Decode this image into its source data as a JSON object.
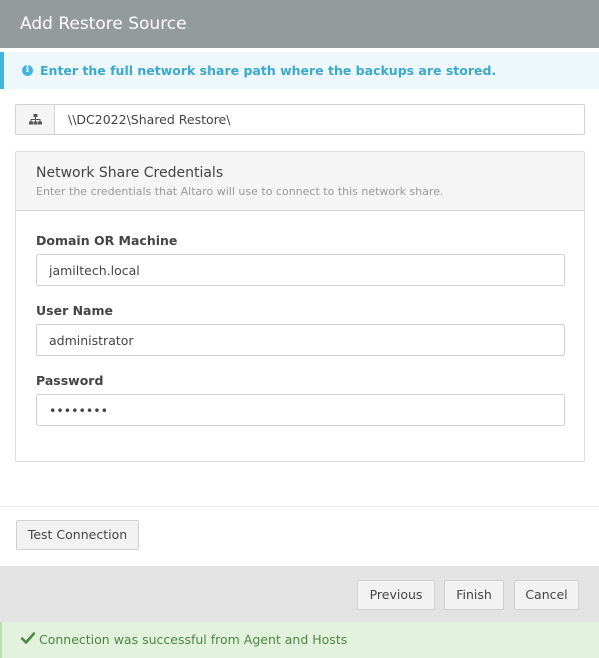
{
  "dialog": {
    "title": "Add Restore Source"
  },
  "info": {
    "message": "Enter the full network share path where the backups are stored.",
    "icon": "info-icon"
  },
  "path": {
    "value": "\\\\DC2022\\Shared Restore\\",
    "icon": "network-icon"
  },
  "credentials": {
    "title": "Network Share Credentials",
    "subtitle": "Enter the credentials that Altaro will use to connect to this network share.",
    "domain_label": "Domain OR Machine",
    "domain_value": "jamiltech.local",
    "username_label": "User Name",
    "username_value": "administrator",
    "password_label": "Password",
    "password_value": "••••••••"
  },
  "actions": {
    "test_connection": "Test Connection"
  },
  "footer": {
    "previous": "Previous",
    "finish": "Finish",
    "cancel": "Cancel"
  },
  "status": {
    "message": "Connection was successful from Agent and Hosts",
    "icon": "check-icon"
  },
  "colors": {
    "titlebar": "#939b9b",
    "info_accent": "#45b6d9",
    "success_text": "#4c8744",
    "success_bg": "#e2f2dd"
  }
}
